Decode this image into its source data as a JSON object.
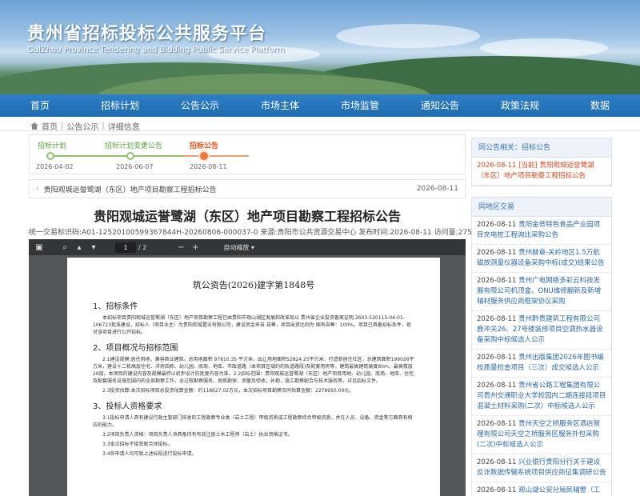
{
  "site": {
    "title": "贵州省招标投标公共服务平台",
    "subtitle": "GuiZhou Province Tendering and Bidding Public Service Platform"
  },
  "nav": [
    "首页",
    "招标计划",
    "公告公示",
    "市场主体",
    "市场监管",
    "通知公告",
    "政策法规",
    "数据"
  ],
  "breadcrumb": [
    "首页",
    "公告公示",
    "详细信息"
  ],
  "progress": {
    "steps": [
      {
        "label": "招标计划",
        "date": "2026-04-02",
        "active": false
      },
      {
        "label": "招标计划变更公告",
        "date": "2026-06-07",
        "active": false
      },
      {
        "label": "招标公告",
        "date": "2026-08-11",
        "active": true
      }
    ]
  },
  "notice": {
    "text": "贵阳观城运誉鹭湖（东区）地产项目勘察工程招标公告",
    "date": "2026-08-11"
  },
  "article": {
    "title": "贵阳观城运誉鹭湖（东区）地产项目勘察工程招标公告",
    "meta": "统一交易标识码:A01-12520100599367844H-20260806-000037-0    来源:贵阳市公共资源交易中心    发布时间:2026-08-11    访问量:275"
  },
  "pdf": {
    "page_current": "1",
    "page_total": "/ 2",
    "zoom": "自动缩放",
    "doc_no": "筑公资告(2026)建字第1848号",
    "s1": "1、招标条件",
    "p1": "本招标项目贵阳观城运誉鹭湖（东区）地产项目勘察工程已由贵阳市观山湖区发展和改革局以 贵州省企业投资备案证明,2603-520115-04-01-106723批准建设，招标人（项目业主）为贵阳和城置业有限公司，建设资金来自 自筹，项目出资比例为 国有自筹：100%。项目已具备招标条件，现对该项目进行公开招标。",
    "s2": "2、项目概况与招标范围",
    "p2": "2.1建设规模:居住用地，兼容商业建筑。总用地面积 97810.35 平方米，出让用地面积52824.25平方米，打造新居住社区，总建筑面积199026平方米，建设十二栋高层住宅、洋房四栋、幼儿园、底商、地库、市政道路（本项目区域约的轨道路段)及配套用房等，建筑最高建筑高度80m，最高楼层26层。本项目的建设内容及规模最终以初步设计的批复内容为准。2.2招标范围：贵阳观城运誉鹭湖（东区）地产项目用地、幼儿园、底商、地库、住宅及配套服务设施范围内的全部勘察工作，全过程勘察服务，地质勘探、测量及验收，补勘，施工勘察配合与技术服务等，详见招标文件。",
    "p3": "2.3投资估算:本次招标项目总投资估算金额：约118627.02万元，本次招标项目勘察合同估算金额：2278950.00元。",
    "s3": "3、投标人资格要求",
    "p4": "3.1投标申请人具有建设行政主管部门核发的工程勘察专业类（岩土工程）甲级资质或工程勘察综合甲级资质，并在人员、设备、资金等方面具有相应的能力。",
    "p5": "3.2项目负责人资格：项目负责人须具备持有有效注册土木工程师（岩土）执业资格证书。",
    "p6": "3.3本次招标不接受联合体投标。",
    "p7": "3.4各申请人均可就上述标段进行投标申请。"
  },
  "sidebar": {
    "related": {
      "title": "同公告相关：招标公告",
      "items": [
        {
          "date": "2026-08-11",
          "text": "[当前] 贵阳观城运誉鹭湖（东区）地产项目勘察工程招标公告",
          "highlight": true
        }
      ]
    },
    "same_area": {
      "title": "同地区交易",
      "items": [
        {
          "date": "2026-08-11",
          "text": "贵阳金蒂特色食品产业园项目充电桩工程询比采购公告"
        },
        {
          "date": "2026-08-11",
          "text": "贵州赫章-关岭地区1.5万航磁放测量仪器设备采购中标(成交)结果公告"
        },
        {
          "date": "2026-08-11",
          "text": "贵州广电网络多彩云科技发展有限公司机顶盒、ONU维修翻新及新增辅材服务供应商框架协议采购"
        },
        {
          "date": "2026-08-11",
          "text": "贵州黔贵建筑工程有限公司鹿冲关26、27号楼装修项目空调热水器设备采购中标候选人公示"
        },
        {
          "date": "2026-08-11",
          "text": "贵州出版集团2026年图书编校质量检查项目（三次）成交候选人公示"
        },
        {
          "date": "2026-08-11",
          "text": "贵州省公路工程集团有限公司贵州交通职业大学校园内二期连接段项目混凝土材料采购(二次）中标候选人公示"
        },
        {
          "date": "2026-08-11",
          "text": "贵州天空之桥服务区酒店管理有限公司天空之桥服务区服务外包采购(二次)中标候选人公示"
        },
        {
          "date": "2026-08-11",
          "text": "兴业银行贵阳分行关于建设反诈数据传输系统项目供应商征集调研公告"
        },
        {
          "date": "2026-08-11",
          "text": "观山湖公安分局民辅警（工勤）购买商业保险服务（四次）竞争性磋商公告"
        }
      ]
    }
  }
}
